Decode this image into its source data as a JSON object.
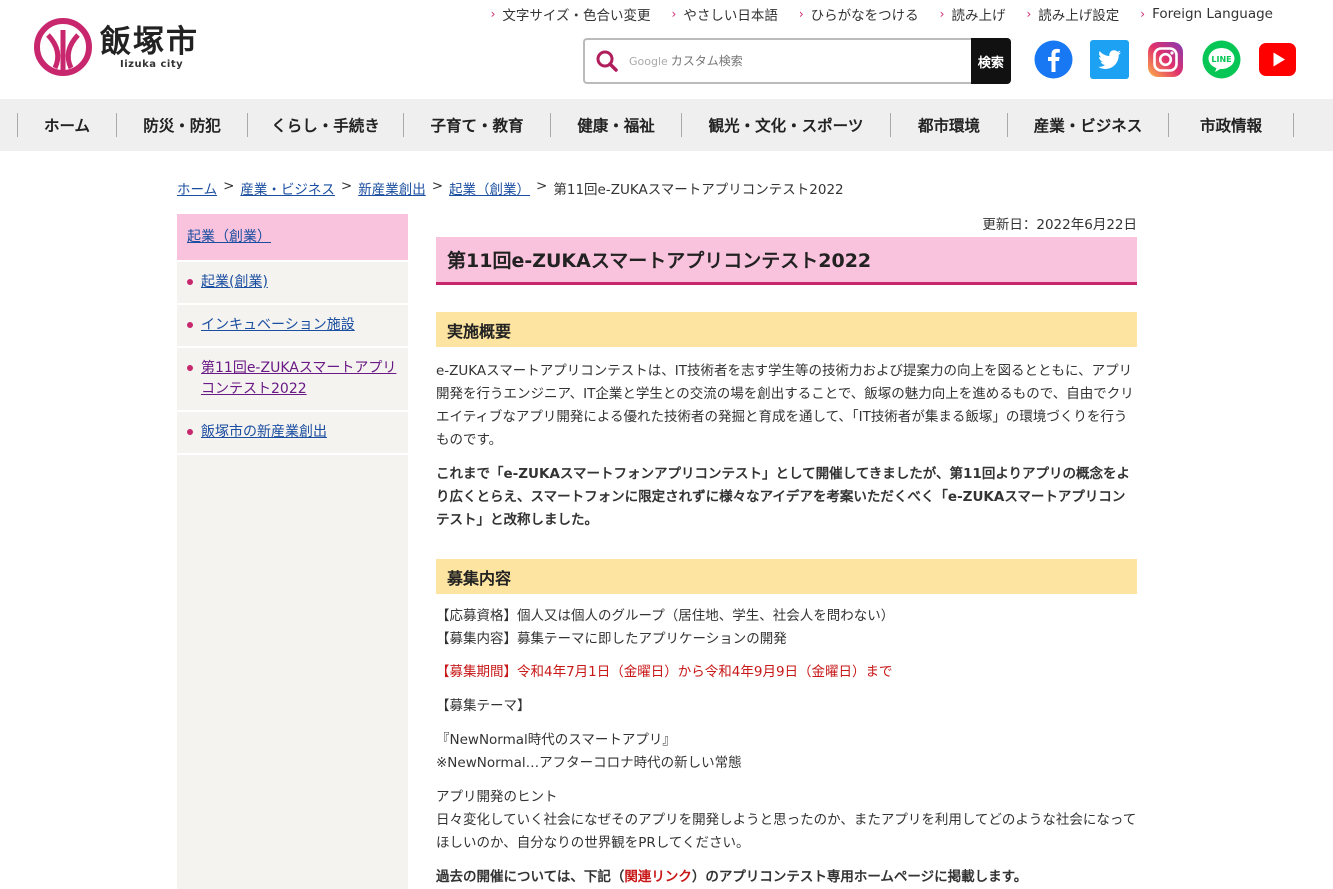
{
  "header": {
    "logo_kanji": "飯塚市",
    "logo_roman": "Iizuka city",
    "util_links": [
      "文字サイズ・色合い変更",
      "やさしい日本語",
      "ひらがなをつける",
      "読み上げ",
      "読み上げ設定",
      "Foreign Language"
    ],
    "search_placeholder": "カスタム検索",
    "search_google": "Google",
    "search_button": "検索",
    "social": [
      "facebook-icon",
      "twitter-icon",
      "instagram-icon",
      "line-icon",
      "youtube-icon"
    ]
  },
  "gnav": [
    "ホーム",
    "防災・防犯",
    "くらし・手続き",
    "子育て・教育",
    "健康・福祉",
    "観光・文化・スポーツ",
    "都市環境",
    "産業・ビジネス",
    "市政情報"
  ],
  "breadcrumb": {
    "links": [
      "ホーム",
      "産業・ビジネス",
      "新産業創出",
      "起業（創業）"
    ],
    "current": "第11回e-ZUKAスマートアプリコンテスト2022",
    "separator": ">"
  },
  "side": {
    "head": "起業（創業）",
    "items": [
      "起業(創業)",
      "インキュベーション施設",
      "第11回e-ZUKAスマートアプリコンテスト2022",
      "飯塚市の新産業創出"
    ]
  },
  "main": {
    "updated": "更新日：2022年6月22日",
    "title": "第11回e-ZUKAスマートアプリコンテスト2022",
    "sec1_heading": "実施概要",
    "sec1_p1": "e-ZUKAスマートアプリコンテストは、IT技術者を志す学生等の技術力および提案力の向上を図るとともに、アプリ開発を行うエンジニア、IT企業と学生との交流の場を創出することで、飯塚の魅力向上を進めるもので、自由でクリエイティブなアプリ開発による優れた技術者の発掘と育成を通して、「IT技術者が集まる飯塚」の環境づくりを行うものです。",
    "sec1_p2": "これまで「e-ZUKAスマートフォンアプリコンテスト」として開催してきましたが、第11回よりアプリの概念をより広くとらえ、スマートフォンに限定されずに様々なアイデアを考案いただくべく「e-ZUKAスマートアプリコンテスト」と改称しました。",
    "sec2_heading": "募集内容",
    "qualification": "【応募資格】個人又は個人のグループ（居住地、学生、社会人を問わない）",
    "content": "【募集内容】募集テーマに即したアプリケーションの開発",
    "period_label": "【募集期間】",
    "period_value": "令和4年7月1日（金曜日）から令和4年9月9日（金曜日）まで",
    "theme_label": "【募集テーマ】",
    "theme_value": "『NewNormal時代のスマートアプリ』",
    "theme_note": "※NewNormal…アフターコロナ時代の新しい常態",
    "hint_label": "アプリ開発のヒント",
    "hint_text": "日々変化していく社会になぜそのアプリを開発しようと思ったのか、またアプリを利用してどのような社会になってほしいのか、自分なりの世界観をPRしてください。",
    "past_before": "過去の開催については、下記（",
    "past_link": "関連リンク",
    "past_after": "）のアプリコンテスト専用ホームページに掲載します。"
  },
  "colors": {
    "accent": "#c8276e",
    "title_bg": "#f9c3dd",
    "heading_bg": "#fde4a0",
    "link": "#1a4ea0",
    "alert": "#c81818"
  }
}
